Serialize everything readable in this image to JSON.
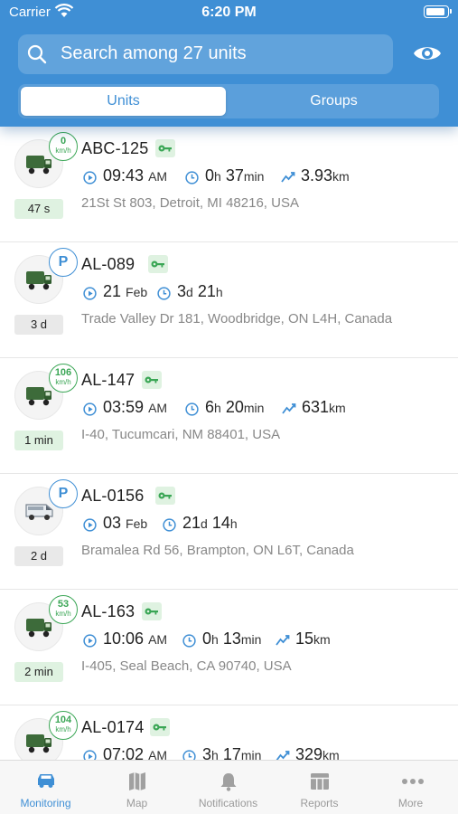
{
  "status_bar": {
    "carrier": "Carrier",
    "time": "6:20 PM"
  },
  "search": {
    "placeholder": "Search among 27 units"
  },
  "segments": {
    "units": "Units",
    "groups": "Groups"
  },
  "units": [
    {
      "name": "ABC-125",
      "state": "moving",
      "speed": "0",
      "speed_unit": "km/h",
      "age": "47 s",
      "time": "09:43",
      "time_suffix": "AM",
      "dur_a": "0",
      "dur_a_unit": "h",
      "dur_b": "37",
      "dur_b_unit": "min",
      "dist": "3.93",
      "dist_unit": "km",
      "address": "21St St 803, Detroit, MI 48216, USA",
      "vehicle": "truck"
    },
    {
      "name": "AL-089",
      "state": "parked",
      "parked_label": "P",
      "age": "3 d",
      "time": "21",
      "time_suffix": "Feb",
      "dur_a": "3",
      "dur_a_unit": "d",
      "dur_b": "21",
      "dur_b_unit": "h",
      "address": "Trade Valley Dr 181, Woodbridge, ON L4H, Canada",
      "vehicle": "truck"
    },
    {
      "name": "AL-147",
      "state": "moving",
      "speed": "106",
      "speed_unit": "km/h",
      "age": "1 min",
      "time": "03:59",
      "time_suffix": "AM",
      "dur_a": "6",
      "dur_a_unit": "h",
      "dur_b": "20",
      "dur_b_unit": "min",
      "dist": "631",
      "dist_unit": "km",
      "address": "I-40, Tucumcari, NM 88401, USA",
      "vehicle": "truck"
    },
    {
      "name": "AL-0156",
      "state": "parked",
      "parked_label": "P",
      "age": "2 d",
      "time": "03",
      "time_suffix": "Feb",
      "dur_a": "21",
      "dur_a_unit": "d",
      "dur_b": "14",
      "dur_b_unit": "h",
      "address": "Bramalea Rd 56, Brampton, ON L6T, Canada",
      "vehicle": "van"
    },
    {
      "name": "AL-163",
      "state": "moving",
      "speed": "53",
      "speed_unit": "km/h",
      "age": "2 min",
      "time": "10:06",
      "time_suffix": "AM",
      "dur_a": "0",
      "dur_a_unit": "h",
      "dur_b": "13",
      "dur_b_unit": "min",
      "dist": "15",
      "dist_unit": "km",
      "address": "I-405, Seal Beach, CA 90740, USA",
      "vehicle": "truck"
    },
    {
      "name": "AL-0174",
      "state": "moving",
      "speed": "104",
      "speed_unit": "km/h",
      "age": "",
      "time": "07:02",
      "time_suffix": "AM",
      "dur_a": "3",
      "dur_a_unit": "h",
      "dur_b": "17",
      "dur_b_unit": "min",
      "dist": "329",
      "dist_unit": "km",
      "address": "",
      "vehicle": "truck"
    }
  ],
  "tabbar": [
    {
      "label": "Monitoring",
      "icon": "car-icon",
      "active": true
    },
    {
      "label": "Map",
      "icon": "map-icon"
    },
    {
      "label": "Notifications",
      "icon": "bell-icon"
    },
    {
      "label": "Reports",
      "icon": "table-icon"
    },
    {
      "label": "More",
      "icon": "more-icon"
    }
  ],
  "colors": {
    "accent": "#3f8fd5",
    "green": "#3aa655",
    "green_bg": "#dff2e1",
    "header": "#3f8fd5"
  }
}
